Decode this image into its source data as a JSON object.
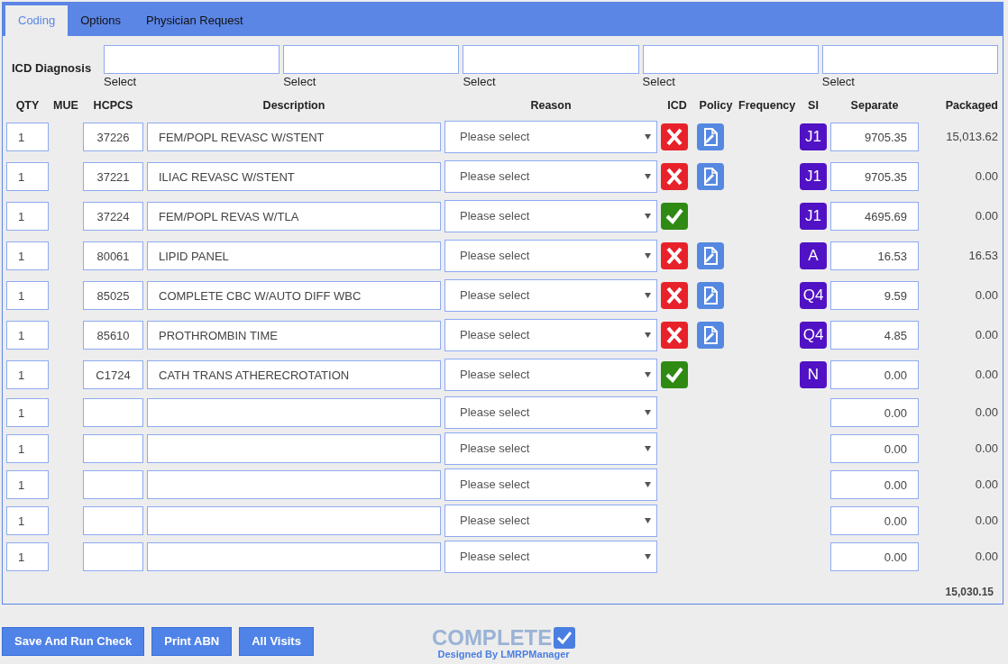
{
  "tabs": [
    {
      "label": "Coding",
      "selected": true
    },
    {
      "label": "Options",
      "selected": false
    },
    {
      "label": "Physician Request",
      "selected": false
    }
  ],
  "icd_diagnosis": {
    "label": "ICD Diagnosis",
    "fields": [
      {
        "hint": "Select"
      },
      {
        "hint": "Select"
      },
      {
        "hint": "Select"
      },
      {
        "hint": "Select"
      },
      {
        "hint": "Select"
      }
    ]
  },
  "table": {
    "columns": [
      "QTY",
      "MUE",
      "HCPCS",
      "Description",
      "Reason",
      "ICD",
      "Policy",
      "Frequency",
      "SI",
      "Separate",
      "Packaged"
    ],
    "rows": [
      {
        "qty": "1",
        "hcpcs": "37226",
        "description": "FEM/POPL REVASC W/STENT",
        "reason": "Please select",
        "icd_valid": false,
        "policy": true,
        "si": "J1",
        "separate": "9705.35",
        "packaged": "15,013.62"
      },
      {
        "qty": "1",
        "hcpcs": "37221",
        "description": "ILIAC REVASC W/STENT",
        "reason": "Please select",
        "icd_valid": false,
        "policy": true,
        "si": "J1",
        "separate": "9705.35",
        "packaged": "0.00"
      },
      {
        "qty": "1",
        "hcpcs": "37224",
        "description": "FEM/POPL REVAS W/TLA",
        "reason": "Please select",
        "icd_valid": true,
        "policy": false,
        "si": "J1",
        "separate": "4695.69",
        "packaged": "0.00"
      },
      {
        "qty": "1",
        "hcpcs": "80061",
        "description": "LIPID PANEL",
        "reason": "Please select",
        "icd_valid": false,
        "policy": true,
        "si": "A",
        "separate": "16.53",
        "packaged": "16.53"
      },
      {
        "qty": "1",
        "hcpcs": "85025",
        "description": "COMPLETE CBC W/AUTO DIFF WBC",
        "reason": "Please select",
        "icd_valid": false,
        "policy": true,
        "si": "Q4",
        "separate": "9.59",
        "packaged": "0.00"
      },
      {
        "qty": "1",
        "hcpcs": "85610",
        "description": "PROTHROMBIN TIME",
        "reason": "Please select",
        "icd_valid": false,
        "policy": true,
        "si": "Q4",
        "separate": "4.85",
        "packaged": "0.00"
      },
      {
        "qty": "1",
        "hcpcs": "C1724",
        "description": "CATH TRANS ATHERECROTATION",
        "reason": "Please select",
        "icd_valid": true,
        "policy": false,
        "si": "N",
        "separate": "0.00",
        "packaged": "0.00"
      },
      {
        "qty": "1",
        "reason": "Please select",
        "separate": "0.00",
        "packaged": "0.00"
      },
      {
        "qty": "1",
        "reason": "Please select",
        "separate": "0.00",
        "packaged": "0.00"
      },
      {
        "qty": "1",
        "reason": "Please select",
        "separate": "0.00",
        "packaged": "0.00"
      },
      {
        "qty": "1",
        "reason": "Please select",
        "separate": "0.00",
        "packaged": "0.00"
      },
      {
        "qty": "1",
        "reason": "Please select",
        "separate": "0.00",
        "packaged": "0.00"
      }
    ],
    "total": "15,030.15"
  },
  "buttons": [
    "Save And Run Check",
    "Print ABN",
    "All Visits"
  ],
  "logo": {
    "title": "COMPLETE",
    "subtitle": "Designed By LMRPManager"
  }
}
